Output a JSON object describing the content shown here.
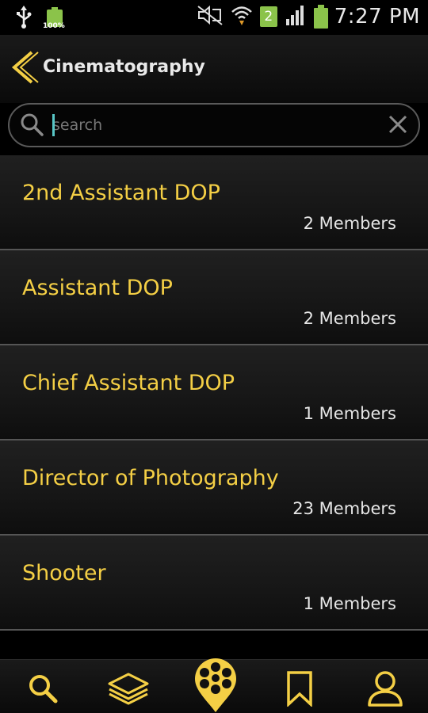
{
  "status_bar": {
    "time": "7:27 PM",
    "battery_small_label": "100%",
    "sim_badge": "2",
    "icons": [
      "usb-icon",
      "battery-icon",
      "mute-icon",
      "wifi-icon",
      "signal-icon",
      "battery-icon"
    ]
  },
  "header": {
    "title": "Cinematography",
    "back_icon": "chevron-left-icon"
  },
  "search": {
    "placeholder": "search",
    "value": ""
  },
  "list": {
    "items": [
      {
        "title": "2nd Assistant DOP",
        "count": "2 Members"
      },
      {
        "title": "Assistant DOP",
        "count": "2 Members"
      },
      {
        "title": "Chief Assistant DOP",
        "count": "1 Members"
      },
      {
        "title": "Director of Photography",
        "count": "23 Members"
      },
      {
        "title": "Shooter",
        "count": "1 Members"
      }
    ]
  },
  "bottom_nav": {
    "items": [
      "search-icon",
      "layers-icon",
      "film-reel-pin-icon",
      "bookmark-icon",
      "profile-icon"
    ],
    "active": "film-reel-pin-icon"
  },
  "colors": {
    "accent": "#f4cf45",
    "background": "#000000",
    "status_green": "#8bc34a"
  }
}
